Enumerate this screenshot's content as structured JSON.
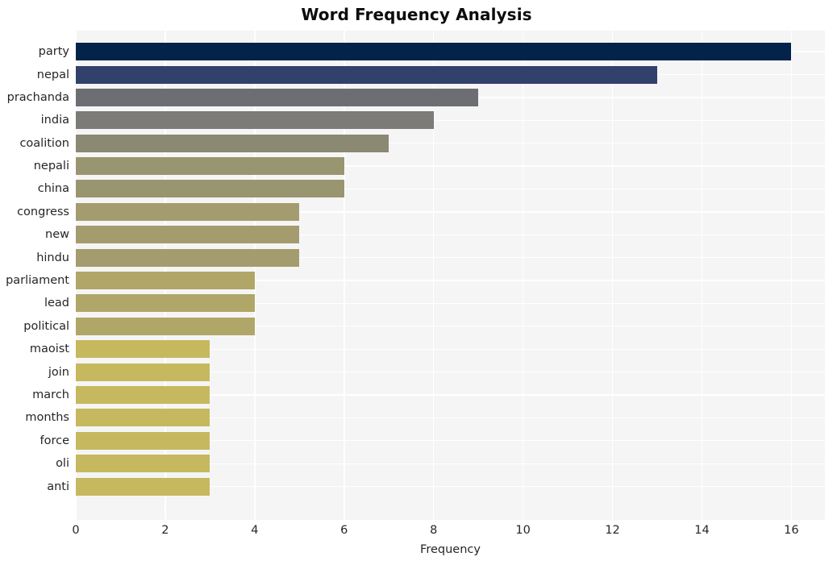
{
  "chart_data": {
    "type": "bar",
    "orientation": "horizontal",
    "title": "Word Frequency Analysis",
    "xlabel": "Frequency",
    "ylabel": "",
    "categories": [
      "party",
      "nepal",
      "prachanda",
      "india",
      "coalition",
      "nepali",
      "china",
      "congress",
      "new",
      "hindu",
      "parliament",
      "lead",
      "political",
      "maoist",
      "join",
      "march",
      "months",
      "force",
      "oli",
      "anti"
    ],
    "values": [
      16,
      13,
      9,
      8,
      7,
      6,
      6,
      5,
      5,
      5,
      4,
      4,
      4,
      3,
      3,
      3,
      3,
      3,
      3,
      3
    ],
    "bar_colors": [
      "#04234b",
      "#32406c",
      "#6c6e73",
      "#7c7b77",
      "#8b8873",
      "#9a9571",
      "#9a9571",
      "#a49c6f",
      "#a49c6f",
      "#a49c6f",
      "#b0a668",
      "#b0a668",
      "#b0a668",
      "#c6b85f",
      "#c6b85f",
      "#c6b85f",
      "#c6b85f",
      "#c6b85f",
      "#c6b85f",
      "#c6b85f"
    ],
    "xticks": [
      0,
      2,
      4,
      6,
      8,
      10,
      12,
      14,
      16
    ],
    "xtick_labels": [
      "0",
      "2",
      "4",
      "6",
      "8",
      "10",
      "12",
      "14",
      "16"
    ],
    "xlim": [
      0,
      16.75
    ],
    "grid": true,
    "grid_color": "#ffffff",
    "plot_background": "#f5f5f5",
    "figure_background": "#ffffff",
    "legend": null,
    "style": "whitegrid"
  }
}
